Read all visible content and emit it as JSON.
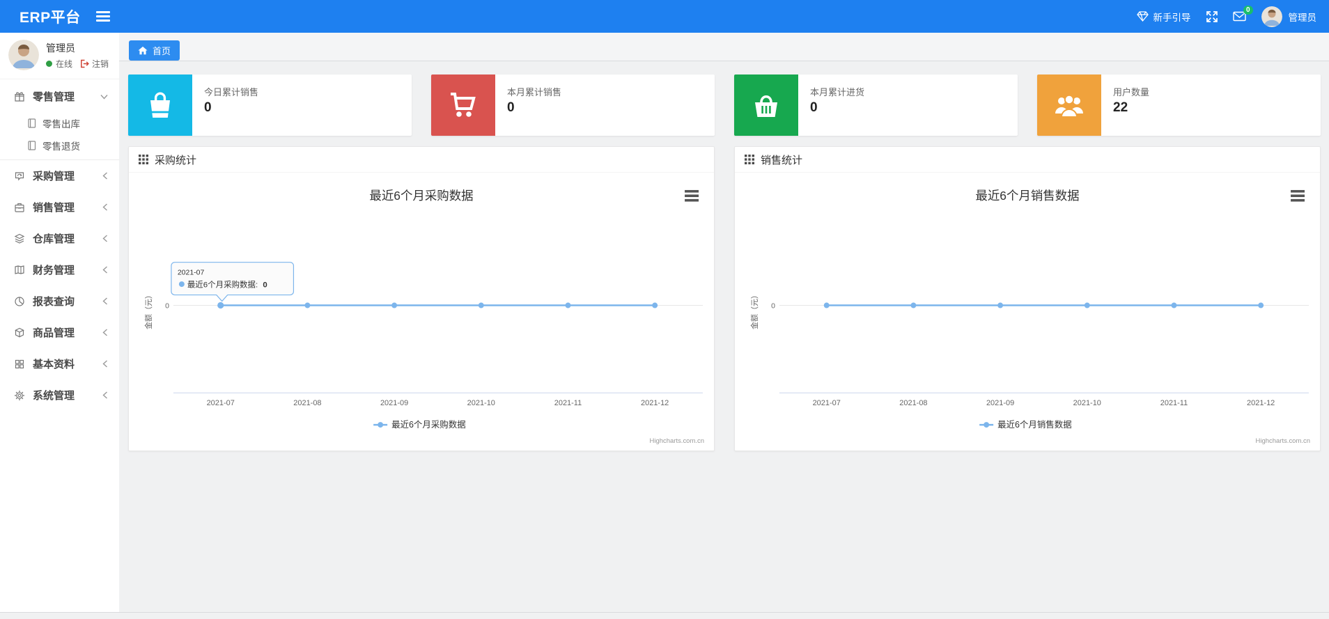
{
  "navbar": {
    "brand": "ERP平台",
    "guide_label": "新手引导",
    "mail_badge": "0",
    "username": "管理员",
    "colors": {
      "navbar_bg": "#1e80f0",
      "badge_green": "#19be6b"
    }
  },
  "sidebar": {
    "user": {
      "name": "管理员",
      "status": "在线",
      "logout_label": "注销",
      "status_color": "#2f9e44"
    },
    "menu": [
      {
        "label": "零售管理",
        "icon": "gift-icon",
        "state": "expanded",
        "children": [
          {
            "label": "零售出库",
            "icon": "notebook-icon"
          },
          {
            "label": "零售退货",
            "icon": "notebook-icon"
          }
        ]
      },
      {
        "label": "采购管理",
        "icon": "loop-box-icon",
        "state": "collapsed"
      },
      {
        "label": "销售管理",
        "icon": "briefcase-icon",
        "state": "collapsed"
      },
      {
        "label": "仓库管理",
        "icon": "layers-icon",
        "state": "collapsed"
      },
      {
        "label": "财务管理",
        "icon": "map-book-icon",
        "state": "collapsed"
      },
      {
        "label": "报表查询",
        "icon": "pie-chart-icon",
        "state": "collapsed"
      },
      {
        "label": "商品管理",
        "icon": "cube-icon",
        "state": "collapsed"
      },
      {
        "label": "基本资料",
        "icon": "grid-icon",
        "state": "collapsed"
      },
      {
        "label": "系统管理",
        "icon": "gear-icon",
        "state": "collapsed"
      }
    ]
  },
  "tab_bar": {
    "home_tab": "首页"
  },
  "cards": [
    {
      "label": "今日累计销售",
      "value": "0",
      "color": "#14b9e6",
      "icon": "shopping-bag-icon"
    },
    {
      "label": "本月累计销售",
      "value": "0",
      "color": "#d9534f",
      "icon": "shopping-cart-icon"
    },
    {
      "label": "本月累计进货",
      "value": "0",
      "color": "#17a84f",
      "icon": "basket-icon"
    },
    {
      "label": "用户数量",
      "value": "22",
      "color": "#f0a23c",
      "icon": "users-icon"
    }
  ],
  "panels": [
    {
      "title": "采购统计"
    },
    {
      "title": "销售统计"
    }
  ],
  "chart_data": [
    {
      "type": "line",
      "title": "最近6个月采购数据",
      "categories": [
        "2021-07",
        "2021-08",
        "2021-09",
        "2021-10",
        "2021-11",
        "2021-12"
      ],
      "series": [
        {
          "name": "最近6个月采购数据",
          "values": [
            0,
            0,
            0,
            0,
            0,
            0
          ]
        }
      ],
      "xlabel": "",
      "ylabel": "金额（元）",
      "ytick_label": "0",
      "ylim": [
        -1,
        1
      ],
      "grid": "zero-gridline-only",
      "legend_position": "bottom",
      "line_color": "#7cb5ec",
      "credits": "Highcharts.com.cn",
      "tooltip": {
        "header": "2021-07",
        "label": "最近6个月采购数据:",
        "value": "0"
      }
    },
    {
      "type": "line",
      "title": "最近6个月销售数据",
      "categories": [
        "2021-07",
        "2021-08",
        "2021-09",
        "2021-10",
        "2021-11",
        "2021-12"
      ],
      "series": [
        {
          "name": "最近6个月销售数据",
          "values": [
            0,
            0,
            0,
            0,
            0,
            0
          ]
        }
      ],
      "xlabel": "",
      "ylabel": "金额（元）",
      "ytick_label": "0",
      "ylim": [
        -1,
        1
      ],
      "grid": "zero-gridline-only",
      "legend_position": "bottom",
      "line_color": "#7cb5ec",
      "credits": "Highcharts.com.cn"
    }
  ]
}
